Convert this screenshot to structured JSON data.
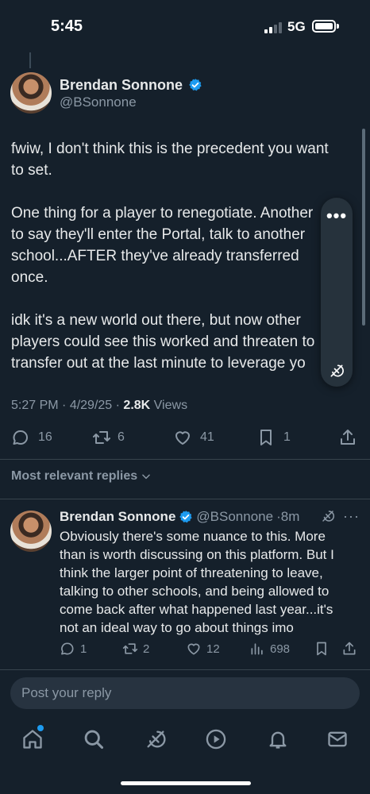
{
  "status_bar": {
    "time": "5:45",
    "network": "5G"
  },
  "tweet": {
    "author_name": "Brendan Sonnone",
    "author_handle": "@BSonnone",
    "text": "fwiw, I don't think this is the precedent you want to set.\n\nOne thing for a player to renegotiate. Another to say they'll enter the Portal, talk to another school...AFTER they've already transferred once.\n\nidk it's a new world out there, but now other players could see this worked and threaten to transfer out at the last minute to leverage yo",
    "time": "5:27 PM",
    "date": "4/29/25",
    "views_count": "2.8K",
    "views_label": "Views",
    "replies": "16",
    "reposts": "6",
    "likes": "41",
    "bookmarks": "1"
  },
  "replies_header": "Most relevant replies",
  "reply": {
    "author_name": "Brendan Sonnone",
    "author_handle": "@BSonnone",
    "age": "·8m",
    "text": "Obviously there's some nuance to this. More than is worth discussing on this platform. But I think the larger point of threatening to leave, talking to other schools, and being allowed to come back after what happened last year...it's not an ideal way to go about things imo",
    "replies": "1",
    "reposts": "2",
    "likes": "12",
    "views": "698"
  },
  "composer": {
    "placeholder": "Post your reply"
  },
  "colors": {
    "background": "#15202b",
    "accent": "#1d9bf0",
    "muted": "#8b98a5"
  },
  "icons": {
    "nav": [
      "home-icon",
      "search-icon",
      "grok-icon",
      "video-icon",
      "notifications-icon",
      "messages-icon"
    ]
  }
}
